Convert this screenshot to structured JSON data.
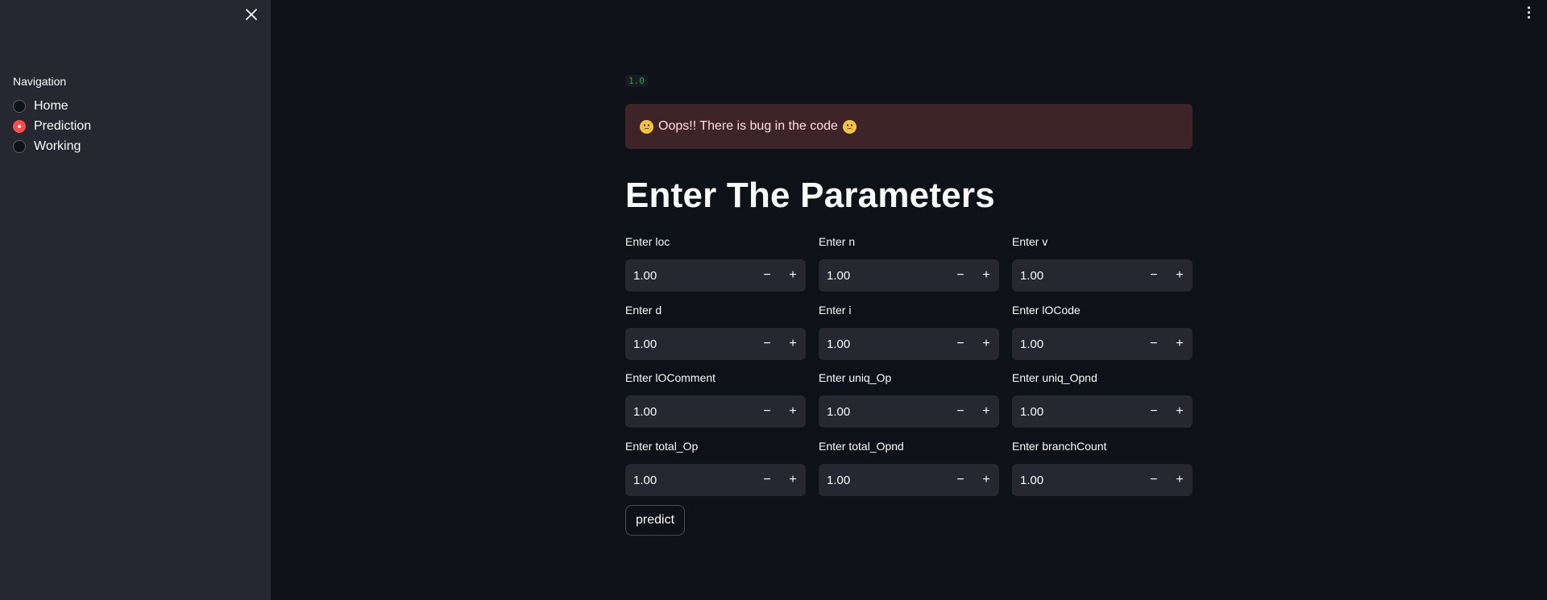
{
  "sidebar": {
    "nav_label": "Navigation",
    "items": [
      {
        "label": "Home",
        "selected": false
      },
      {
        "label": "Prediction",
        "selected": true
      },
      {
        "label": "Working",
        "selected": false
      }
    ]
  },
  "main": {
    "version": "1.0",
    "error_message": "Oops!! There is bug in the code",
    "title": "Enter The Parameters",
    "fields": [
      {
        "label": "Enter loc",
        "value": "1.00"
      },
      {
        "label": "Enter n",
        "value": "1.00"
      },
      {
        "label": "Enter v",
        "value": "1.00"
      },
      {
        "label": "Enter d",
        "value": "1.00"
      },
      {
        "label": "Enter i",
        "value": "1.00"
      },
      {
        "label": "Enter lOCode",
        "value": "1.00"
      },
      {
        "label": "Enter lOComment",
        "value": "1.00"
      },
      {
        "label": "Enter uniq_Op",
        "value": "1.00"
      },
      {
        "label": "Enter uniq_Opnd",
        "value": "1.00"
      },
      {
        "label": "Enter total_Op",
        "value": "1.00"
      },
      {
        "label": "Enter total_Opnd",
        "value": "1.00"
      },
      {
        "label": "Enter branchCount",
        "value": "1.00"
      }
    ],
    "minus_label": "−",
    "plus_label": "+",
    "predict_label": "predict"
  },
  "colors": {
    "background": "#0e1117",
    "sidebar": "#262730",
    "accent": "#ff4b4b",
    "error_bg": "#3e2428",
    "version_text": "#09ab3b"
  }
}
